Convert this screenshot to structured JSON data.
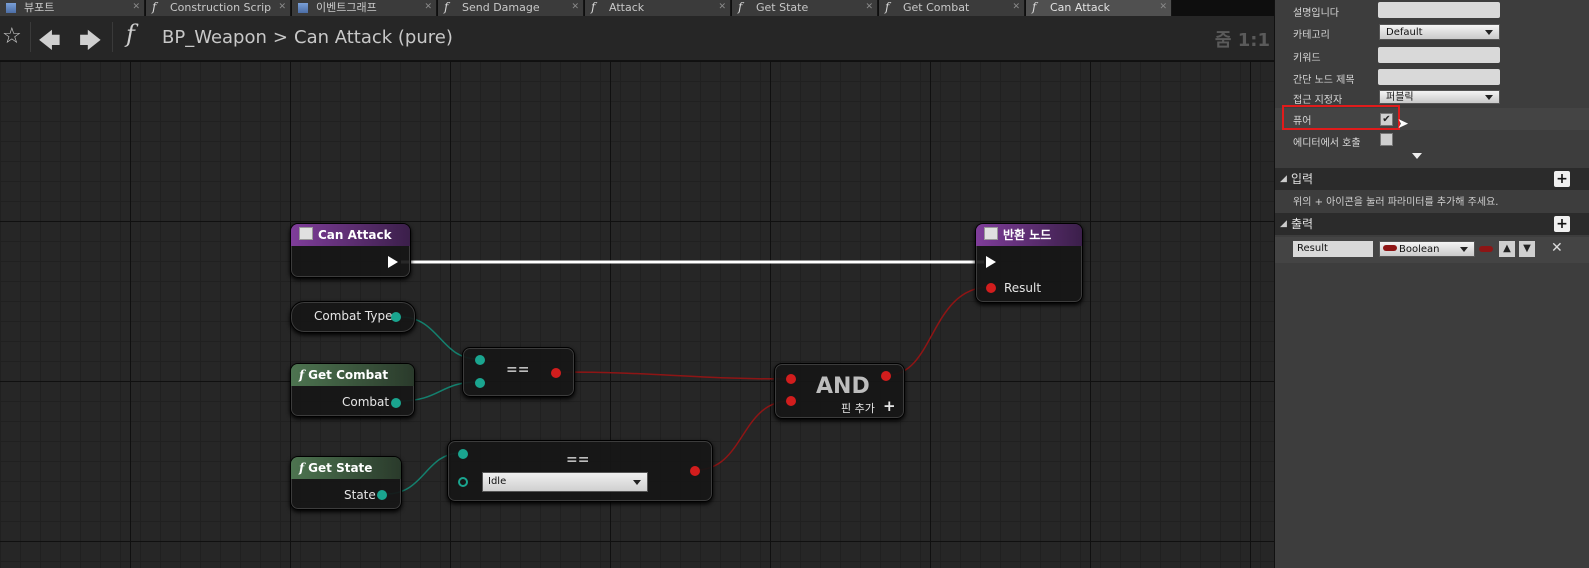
{
  "tabs": [
    {
      "icon": "grid-icon",
      "label": "뷰포트",
      "active": false
    },
    {
      "icon": "function-icon",
      "label": "Construction Scrip",
      "active": false
    },
    {
      "icon": "event-graph-icon",
      "label": "이벤트그래프",
      "active": false
    },
    {
      "icon": "function-icon",
      "label": "Send Damage",
      "active": false
    },
    {
      "icon": "function-icon",
      "label": "Attack",
      "active": false
    },
    {
      "icon": "function-icon",
      "label": "Get State",
      "active": false
    },
    {
      "icon": "function-icon",
      "label": "Get Combat",
      "active": false
    },
    {
      "icon": "function-icon",
      "label": "Can Attack",
      "active": true
    }
  ],
  "toolbar": {
    "function_glyph": "f",
    "breadcrumb_root": "BP_Weapon",
    "breadcrumb_sep": ">",
    "breadcrumb_current": "Can Attack (pure)",
    "zoom": "줌 1:1"
  },
  "graph": {
    "entry_node": {
      "title": "Can Attack"
    },
    "return_node": {
      "title": "반환 노드",
      "result_pin": "Result"
    },
    "combat_type_var": {
      "label": "Combat Type"
    },
    "get_combat_node": {
      "title": "Get Combat",
      "output_pin": "Combat"
    },
    "get_state_node": {
      "title": "Get State",
      "output_pin": "State"
    },
    "equal_node_1": {
      "op": "=="
    },
    "equal_node_2": {
      "op": "==",
      "enum_value": "Idle"
    },
    "and_node": {
      "title": "AND",
      "add_pin_label": "핀 추가",
      "add_pin_glyph": "+"
    }
  },
  "details": {
    "rows": [
      {
        "label": "설명입니다",
        "type": "text",
        "value": ""
      },
      {
        "label": "카테고리",
        "type": "select",
        "value": "Default"
      },
      {
        "label": "키워드",
        "type": "text",
        "value": ""
      },
      {
        "label": "간단 노드 제목",
        "type": "text",
        "value": ""
      },
      {
        "label": "접근 지정자",
        "type": "select",
        "value": "퍼블릭"
      },
      {
        "label": "퓨어",
        "type": "checkbox",
        "checked": true
      },
      {
        "label": "에디터에서 호출",
        "type": "checkbox",
        "checked": false
      }
    ],
    "inputs_section": {
      "title": "입력",
      "hint": "위의 + 아이콘을 눌러 파라미터를 추가해 주세요."
    },
    "outputs_section": {
      "title": "출력",
      "params": [
        {
          "name": "Result",
          "type": "Boolean"
        }
      ]
    }
  },
  "colors": {
    "highlight_box": "#e01b1b",
    "bool_pin": "#d21d1d",
    "struct_pin": "#1aa58f",
    "exec_wire": "#ffffff"
  }
}
